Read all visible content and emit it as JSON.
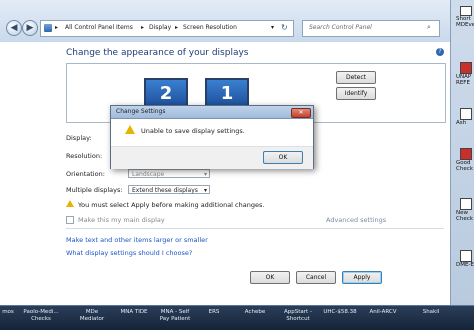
{
  "address_bar": {
    "crumbs": [
      "All Control Panel Items",
      "Display",
      "Screen Resolution"
    ],
    "separator": "▸",
    "search_placeholder": "Search Control Panel"
  },
  "main": {
    "heading": "Change the appearance of your displays",
    "monitor_2": "2",
    "monitor_1": "1",
    "detect_label": "Detect",
    "identify_label": "Identify",
    "display_label": "Display:",
    "resolution_label": "Resolution:",
    "orientation_label": "Orientation:",
    "orientation_value": "Landscape",
    "multiple_displays_label": "Multiple displays:",
    "multiple_displays_value": "Extend these displays",
    "warning_text": "You must select Apply before making additional changes.",
    "make_main_label": "Make this my main display",
    "advanced_settings": "Advanced settings",
    "link_text_size": "Make text and other items larger or smaller",
    "link_settings": "What display settings should I choose?",
    "ok_label": "OK",
    "cancel_label": "Cancel",
    "apply_label": "Apply"
  },
  "dialog": {
    "title": "Change Settings",
    "message": "Unable to save display settings.",
    "ok_label": "OK"
  },
  "desktop_icons": [
    {
      "lines": [
        "Short",
        "MDEve"
      ]
    },
    {
      "lines": [
        "UNAP",
        "REFE"
      ]
    },
    {
      "lines": [
        "Ash"
      ]
    },
    {
      "lines": [
        "Good",
        "Check"
      ]
    },
    {
      "lines": [
        "New",
        "Check"
      ]
    },
    {
      "lines": [
        "DME-E"
      ]
    }
  ],
  "taskbar": {
    "items": [
      {
        "lines": [
          "mos"
        ]
      },
      {
        "lines": [
          "Paolo-Medi...",
          "Checks"
        ]
      },
      {
        "lines": [
          "MDe",
          "Mediator"
        ]
      },
      {
        "lines": [
          "MNA TIDE"
        ]
      },
      {
        "lines": [
          "MNA - Self",
          "Pay Patient"
        ]
      },
      {
        "lines": [
          "ERS"
        ]
      },
      {
        "lines": [
          "Achebe"
        ]
      },
      {
        "lines": [
          "AppStart -",
          "Shortcut"
        ]
      },
      {
        "lines": [
          "UHC-$58.38"
        ]
      },
      {
        "lines": [
          "Anil-ARCV"
        ]
      },
      {
        "lines": [
          "Shakil"
        ]
      }
    ]
  },
  "colors": {
    "heading": "#1e3d78",
    "link": "#1b55c4",
    "monitor_fill": "#2a69bf",
    "warning": "#e5b400"
  },
  "icons": {
    "back": "arrow-left-icon",
    "forward": "arrow-right-icon",
    "control_panel": "control-panel-icon",
    "refresh": "refresh-icon",
    "search": "search-icon",
    "warning": "warning-icon",
    "help": "help-icon"
  }
}
